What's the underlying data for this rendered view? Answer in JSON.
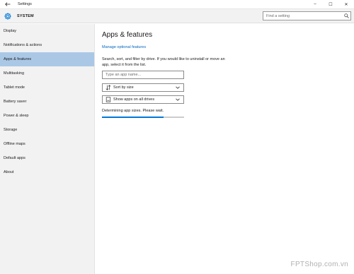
{
  "window": {
    "title": "Settings",
    "controls": {
      "minimize": "–",
      "maximize": "☐",
      "close": "✕"
    }
  },
  "header": {
    "section": "SYSTEM",
    "search_placeholder": "Find a setting"
  },
  "sidebar": {
    "items": [
      {
        "label": "Display"
      },
      {
        "label": "Notifications & actions"
      },
      {
        "label": "Apps & features",
        "active": true
      },
      {
        "label": "Multitasking"
      },
      {
        "label": "Tablet mode"
      },
      {
        "label": "Battery saver"
      },
      {
        "label": "Power & sleep"
      },
      {
        "label": "Storage"
      },
      {
        "label": "Offline maps"
      },
      {
        "label": "Default apps"
      },
      {
        "label": "About"
      }
    ]
  },
  "main": {
    "title": "Apps & features",
    "optional_features_link": "Manage optional features",
    "description": "Search, sort, and filter by drive. If you would like to uninstall or move an app, select it from the list.",
    "app_search_placeholder": "Type an app name...",
    "sort_dropdown": {
      "selected": "Sort by size"
    },
    "drive_dropdown": {
      "selected": "Show apps on all drives"
    },
    "status": "Determining app sizes. Please wait.",
    "progress": 0.75
  },
  "watermark": "FPTShop.com.vn",
  "colors": {
    "accent": "#0078d7",
    "selection": "#aac8e6",
    "link": "#0066c0",
    "sidebar_bg": "#f2f2f2"
  },
  "icons": {
    "back": "back-arrow-icon",
    "settings": "gear-icon",
    "search": "search-icon",
    "sort": "sort-icon",
    "drive": "drive-icon",
    "chevron": "chevron-down-icon"
  }
}
